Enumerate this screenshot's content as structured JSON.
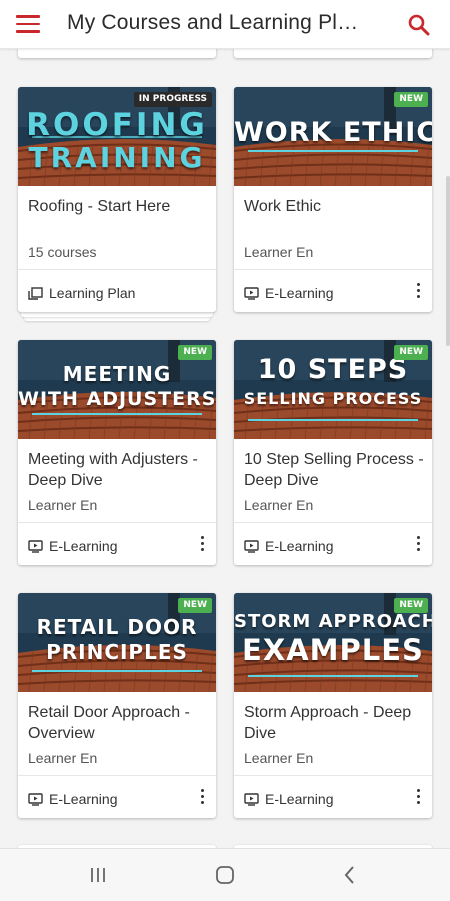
{
  "app_bar": {
    "title": "My Courses and Learning Pl…",
    "menu_icon": "hamburger-menu-icon",
    "search_icon": "search-icon",
    "accent": "#c9282d"
  },
  "cards": [
    {
      "thumb_lines": [
        "ROOFING",
        "TRAINING"
      ],
      "thumb_style": "teal",
      "badge": "IN PROGRESS",
      "title": "Roofing - Start Here",
      "subtitle": "15 courses",
      "type_label": "Learning Plan",
      "type_icon": "learning-plan-icon"
    },
    {
      "thumb_lines": [
        "WORK ETHIC"
      ],
      "thumb_style": "white",
      "badge": "NEW",
      "title": "Work Ethic",
      "subtitle": "Learner En",
      "type_label": "E-Learning",
      "type_icon": "elearning-icon"
    },
    {
      "thumb_lines": [
        "MEETING",
        "WITH ADJUSTERS"
      ],
      "thumb_style": "white",
      "badge": "NEW",
      "title": "Meeting with Adjusters - Deep Dive",
      "subtitle": "Learner En",
      "type_label": "E-Learning",
      "type_icon": "elearning-icon"
    },
    {
      "thumb_lines": [
        "10 STEPS",
        "SELLING PROCESS"
      ],
      "thumb_style": "white",
      "badge": "NEW",
      "title": "10 Step Selling Process - Deep Dive",
      "subtitle": "Learner En",
      "type_label": "E-Learning",
      "type_icon": "elearning-icon"
    },
    {
      "thumb_lines": [
        "RETAIL DOOR",
        "PRINCIPLES"
      ],
      "thumb_style": "white",
      "badge": "NEW",
      "title": "Retail Door Approach - Overview",
      "subtitle": "Learner En",
      "type_label": "E-Learning",
      "type_icon": "elearning-icon"
    },
    {
      "thumb_lines": [
        "STORM APPROACH",
        "EXAMPLES"
      ],
      "thumb_style": "white",
      "badge": "NEW",
      "title": "Storm Approach - Deep Dive",
      "subtitle": "Learner En",
      "type_label": "E-Learning",
      "type_icon": "elearning-icon"
    }
  ],
  "nav_bar": {
    "recent_icon": "recent-apps-icon",
    "home_icon": "home-icon",
    "back_icon": "back-icon"
  }
}
